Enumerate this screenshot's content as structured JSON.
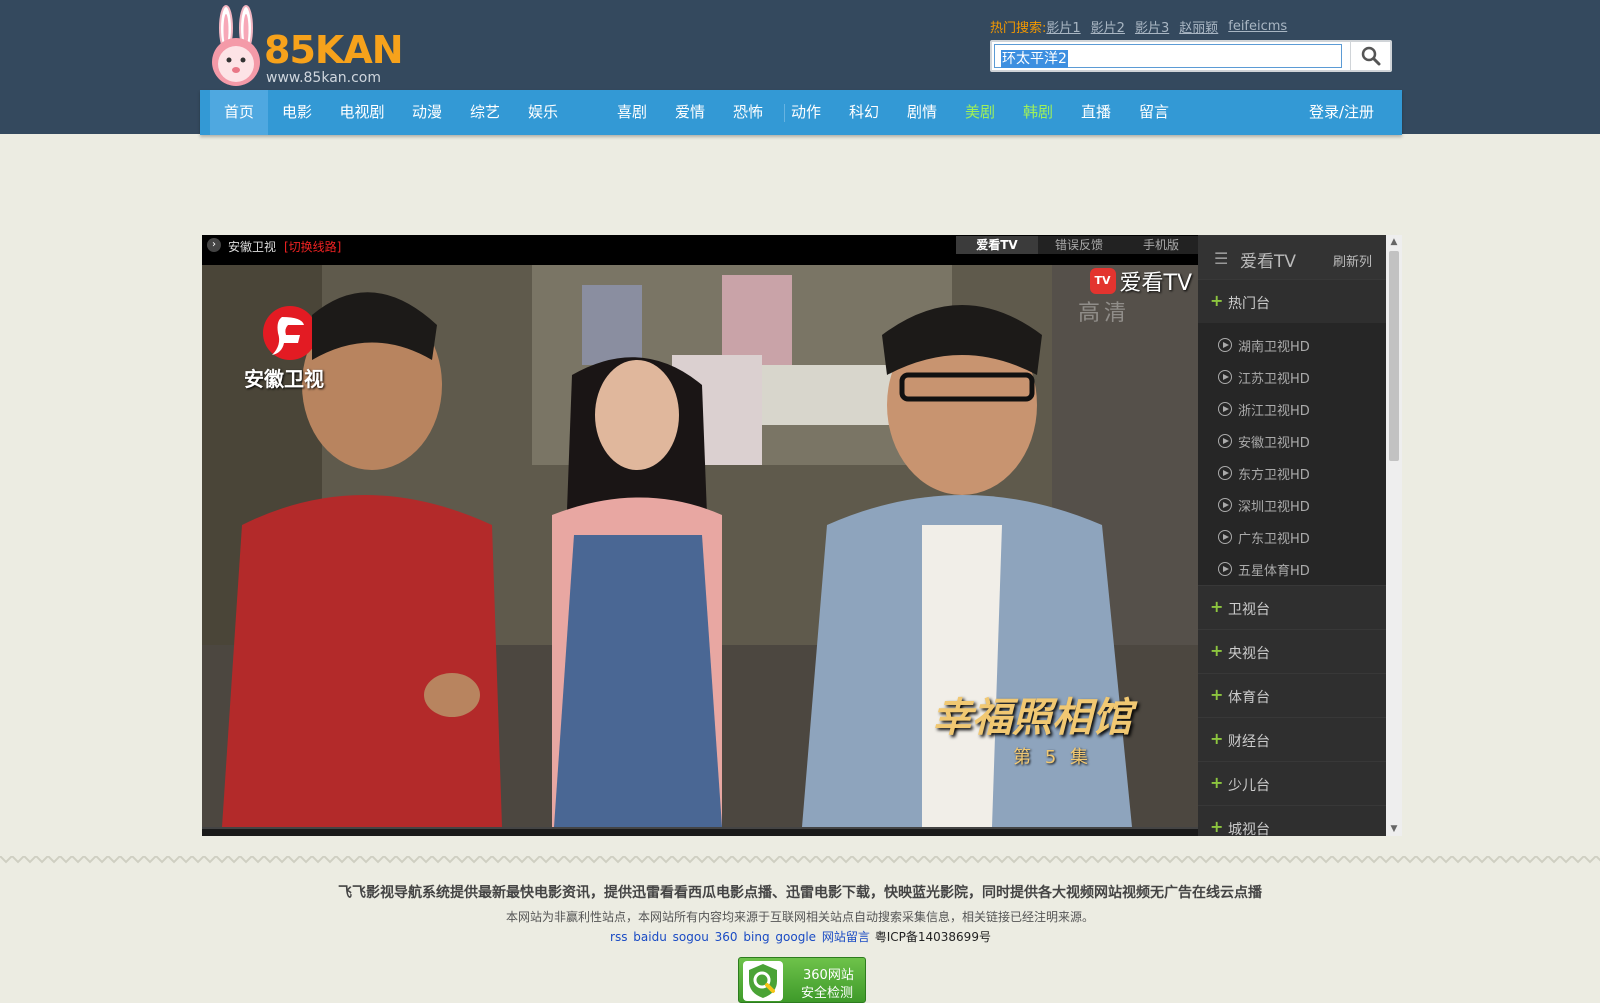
{
  "header": {
    "logo_text": "85KAN",
    "logo_url": "www.85kan.com",
    "hot_search_label": "热门搜索:",
    "hot_search_items": [
      "影片1",
      "影片2",
      "影片3",
      "赵丽颖",
      "feifeicms"
    ],
    "search_value": "环太平洋2"
  },
  "nav": {
    "items": [
      "首页",
      "电影",
      "电视剧",
      "动漫",
      "综艺",
      "娱乐",
      "喜剧",
      "爱情",
      "恐怖",
      "动作",
      "科幻",
      "剧情",
      "美剧",
      "韩剧",
      "直播",
      "留言"
    ],
    "login": "登录/注册"
  },
  "player": {
    "channel": "安徽卫视",
    "switch_line": "[切换线路]",
    "tabs": [
      "爱看TV",
      "错误反馈",
      "手机版"
    ],
    "station_logo_text": "安徽卫视",
    "watermark_icon": "TV",
    "watermark_text": "爱看TV",
    "watermark_hd": "高清",
    "show_title": "幸福照相馆",
    "show_episode": "第 5 集"
  },
  "sidebar": {
    "title": "爱看TV",
    "refresh": "刷新列",
    "groups": [
      "热门台",
      "卫视台",
      "央视台",
      "体育台",
      "财经台",
      "少儿台",
      "城视台"
    ],
    "hot_channels": [
      "湖南卫视HD",
      "江苏卫视HD",
      "浙江卫视HD",
      "安徽卫视HD",
      "东方卫视HD",
      "深圳卫视HD",
      "广东卫视HD",
      "五星体育HD"
    ]
  },
  "footer": {
    "main": "飞飞影视导航系统提供最新最快电影资讯，提供迅雷看看西瓜电影点播、迅雷电影下载，快映蓝光影院，同时提供各大视频网站视频无广告在线云点播",
    "sub": "本网站为非赢利性站点，本网站所有内容均来源于互联网相关站点自动搜索采集信息，相关链接已经注明来源。",
    "links": [
      "rss",
      "baidu",
      "sogou",
      "360",
      "bing",
      "google",
      "网站留言"
    ],
    "icp": "粤ICP备14038699号",
    "badge_line1": "360网站",
    "badge_line2": "安全检测"
  },
  "colors": {
    "header_bg": "#34495e",
    "nav_bg": "#3399d5",
    "accent_orange": "#f7a21b",
    "green_nav": "#9ff05a"
  }
}
